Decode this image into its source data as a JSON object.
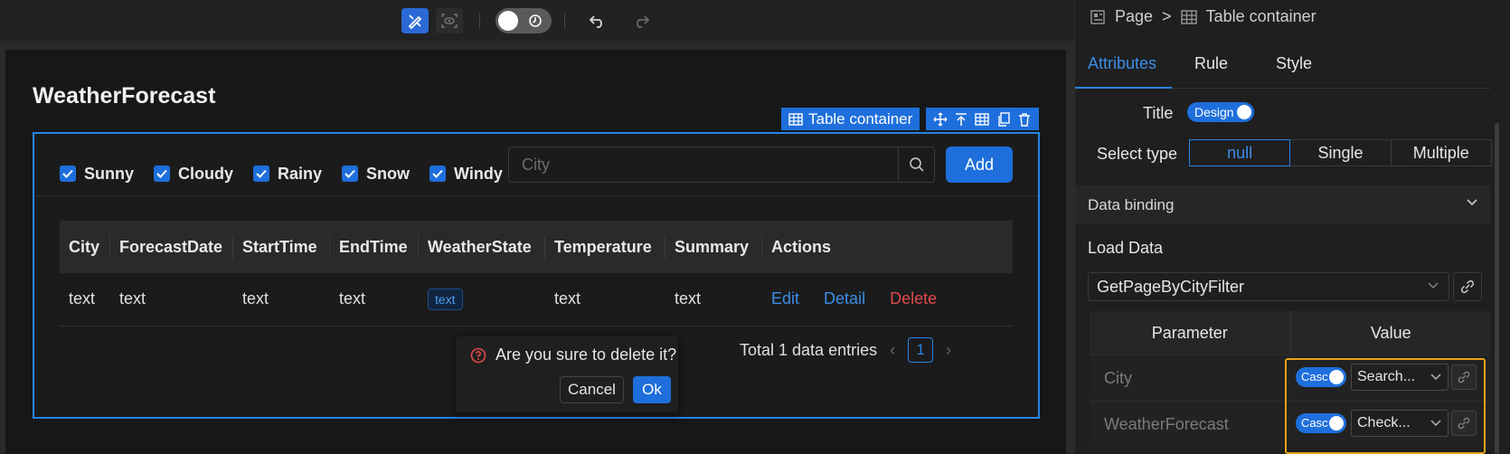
{
  "toolbar": {
    "design_mode_icon": "pencil-ruler-icon",
    "preview_icon": "eye-scan-icon",
    "theme_toggle_icon": "clock-icon",
    "undo_icon": "undo-icon",
    "redo_icon": "redo-icon"
  },
  "canvas": {
    "page_title": "WeatherForecast",
    "table_container_label": "Table container",
    "filters": [
      "Sunny",
      "Cloudy",
      "Rainy",
      "Snow",
      "Windy"
    ],
    "search_placeholder": "City",
    "add_label": "Add",
    "columns": [
      "City",
      "ForecastDate",
      "StartTime",
      "EndTime",
      "WeatherState",
      "Temperature",
      "Summary",
      "Actions"
    ],
    "row": {
      "city": "text",
      "forecast_date": "text",
      "start_time": "text",
      "end_time": "text",
      "weather_state": "text",
      "temperature": "text",
      "summary": "text",
      "actions": [
        "Edit",
        "Detail",
        "Delete"
      ]
    },
    "total_text": "Total 1 data entries",
    "current_page": "1",
    "popconfirm": {
      "message": "Are you sure to delete it?",
      "cancel": "Cancel",
      "ok": "Ok"
    }
  },
  "panel": {
    "breadcrumb": [
      "Page",
      ">",
      "Table container"
    ],
    "tabs": [
      "Attributes",
      "Rule",
      "Style"
    ],
    "title_label": "Title",
    "title_switch": "Design",
    "select_type_label": "Select type",
    "select_type_options": [
      "null",
      "Single",
      "Multiple"
    ],
    "data_binding_label": "Data binding",
    "load_data_label": "Load Data",
    "load_data_value": "GetPageByCityFilter",
    "param_headers": [
      "Parameter",
      "Value"
    ],
    "params": [
      {
        "name": "City",
        "switch": "Casc",
        "value": "Search..."
      },
      {
        "name": "WeatherForecast",
        "switch": "Casc",
        "value": "Check..."
      }
    ]
  },
  "colors": {
    "accent": "#1e6fdc",
    "danger": "#e04b4b",
    "highlight": "#e6a31a"
  }
}
